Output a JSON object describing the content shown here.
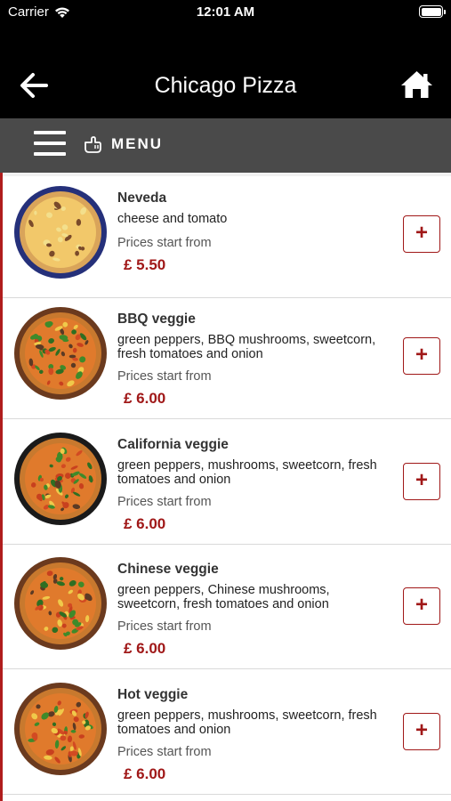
{
  "status_bar": {
    "carrier": "Carrier",
    "time": "12:01 AM"
  },
  "nav": {
    "title": "Chicago Pizza",
    "back_icon": "arrow-left-icon",
    "home_icon": "home-icon"
  },
  "menu_bar": {
    "label": "MENU",
    "hamburger_icon": "hamburger-icon",
    "hand_icon": "hand-pointer-icon"
  },
  "items": [
    {
      "name": "Neveda",
      "description": "cheese and tomato",
      "price_label": "Prices start from",
      "price": "£ 5.50",
      "add_label": "+"
    },
    {
      "name": "BBQ veggie",
      "description": "green peppers, BBQ mushrooms, sweetcorn, fresh tomatoes and onion",
      "price_label": "Prices start from",
      "price": "£ 6.00",
      "add_label": "+"
    },
    {
      "name": "California veggie",
      "description": "green peppers, mushrooms, sweetcorn, fresh tomatoes and onion",
      "price_label": "Prices start from",
      "price": "£ 6.00",
      "add_label": "+"
    },
    {
      "name": "Chinese veggie",
      "description": "green peppers, Chinese mushrooms, sweetcorn, fresh tomatoes and onion",
      "price_label": "Prices start from",
      "price": "£ 6.00",
      "add_label": "+"
    },
    {
      "name": "Hot veggie",
      "description": "green peppers, mushrooms, sweetcorn, fresh tomatoes and onion",
      "price_label": "Prices start from",
      "price": "£ 6.00",
      "add_label": "+"
    }
  ],
  "colors": {
    "accent": "#a01818",
    "nav_bg": "#000000",
    "menu_bar_bg": "#4a4a4a"
  }
}
